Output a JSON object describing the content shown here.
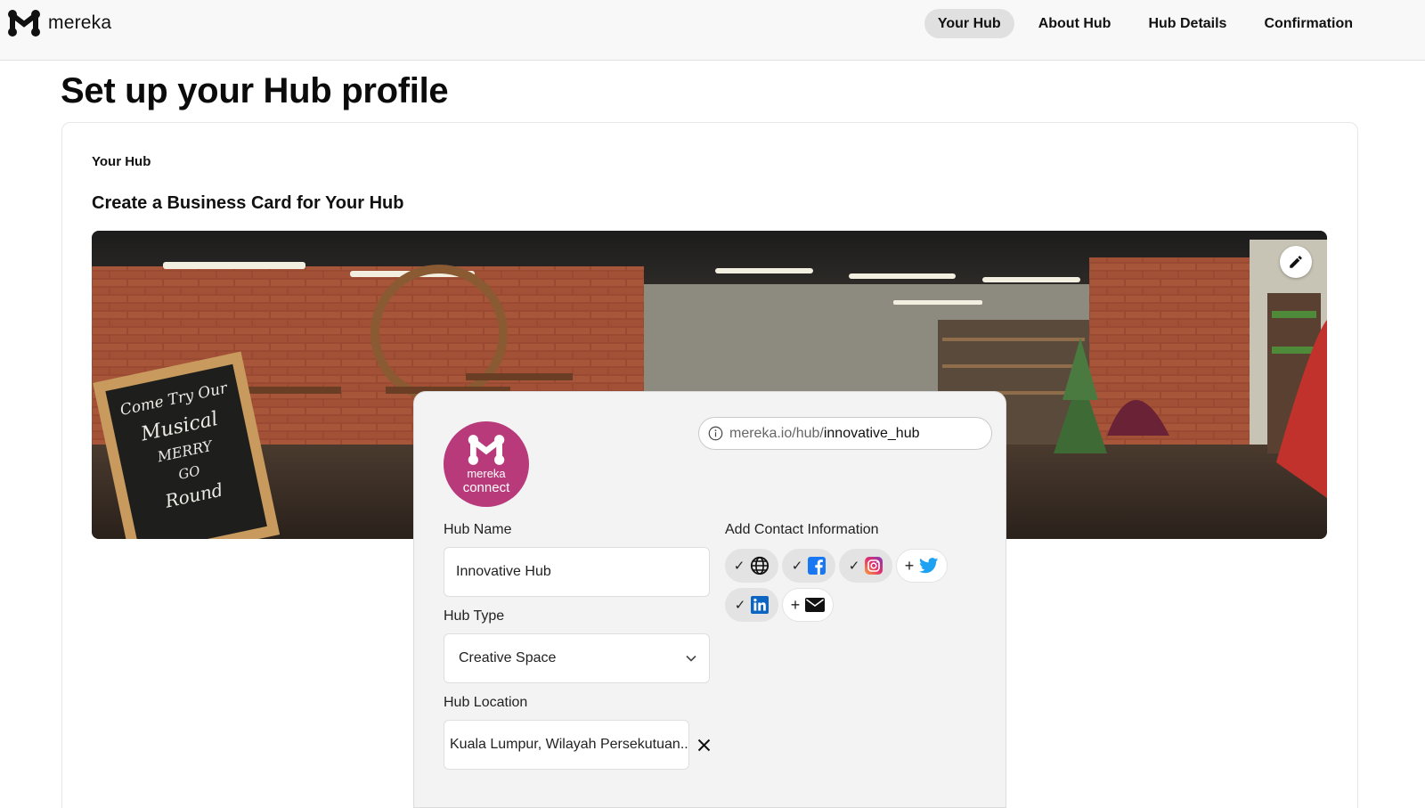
{
  "brand": {
    "name": "mereka",
    "icon": "mereka-logo-icon"
  },
  "nav": {
    "items": [
      {
        "label": "Your Hub",
        "active": true
      },
      {
        "label": "About Hub",
        "active": false
      },
      {
        "label": "Hub Details",
        "active": false
      },
      {
        "label": "Confirmation",
        "active": false
      }
    ]
  },
  "page": {
    "title": "Set up your Hub profile",
    "step": "Your Hub",
    "section_title": "Create a Business Card for Your Hub"
  },
  "banner": {
    "chalkboard_text": [
      "Come Try Our",
      "Musical",
      "MERRY",
      "GO",
      "Round"
    ]
  },
  "card": {
    "logo_line1": "mereka",
    "logo_line2": "connect",
    "url_prefix": "mereka.io/hub/",
    "url_value": "innovative_hub",
    "hub_name_label": "Hub Name",
    "hub_name_value": "Innovative Hub",
    "hub_type_label": "Hub Type",
    "hub_type_value": "Creative Space",
    "hub_location_label": "Hub Location",
    "hub_location_value": "Kuala Lumpur, Wilayah Persekutuan...",
    "contact_label": "Add Contact Information",
    "contacts": [
      {
        "name": "website",
        "state": "added",
        "mark": "✓"
      },
      {
        "name": "facebook",
        "state": "added",
        "mark": "✓"
      },
      {
        "name": "instagram",
        "state": "added",
        "mark": "✓"
      },
      {
        "name": "twitter",
        "state": "add",
        "mark": "+"
      },
      {
        "name": "linkedin",
        "state": "added",
        "mark": "✓"
      },
      {
        "name": "email",
        "state": "add",
        "mark": "+"
      }
    ]
  },
  "colors": {
    "brand_magenta": "#b83a7a",
    "facebook": "#1877f2",
    "twitter": "#1da1f2",
    "linkedin": "#0a66c2"
  }
}
